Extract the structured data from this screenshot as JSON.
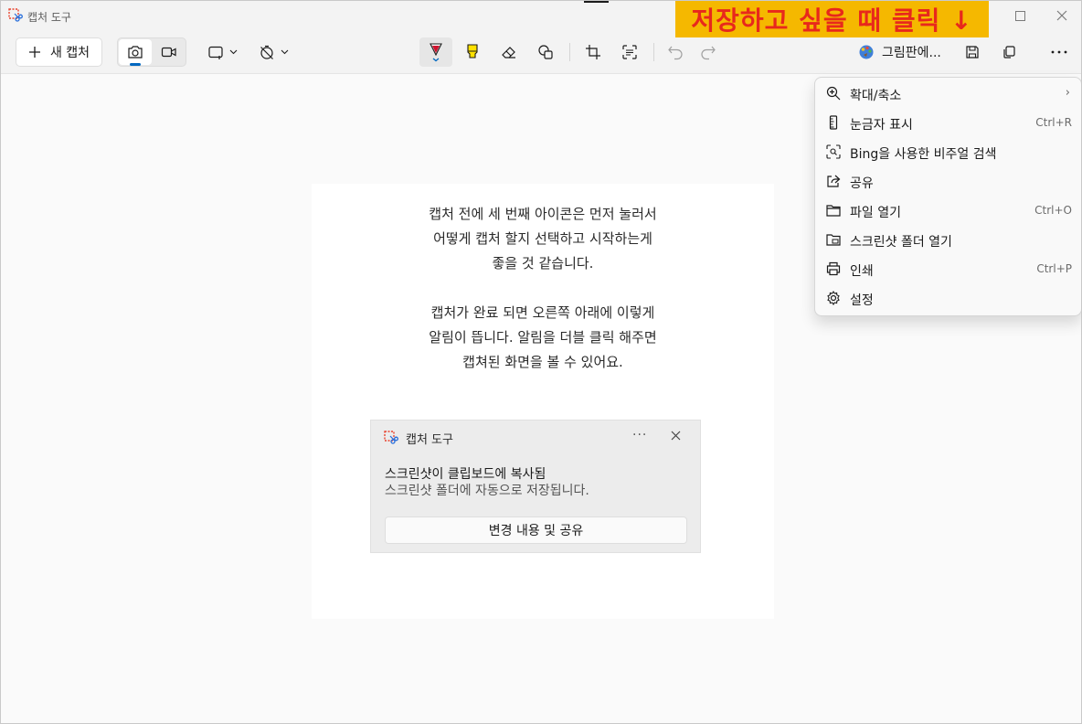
{
  "window": {
    "title": "캡처 도구"
  },
  "annotation": {
    "text": "저장하고 싶을 때 클릭 ↓",
    "bg_color": "#f5b800",
    "text_color": "#e8281c"
  },
  "toolbar": {
    "new_capture_label": "새 캡처",
    "paint_label": "그림판에...",
    "icons": [
      "camera-icon",
      "video-icon",
      "rect-select-icon",
      "no-timer-icon",
      "pen-icon",
      "highlighter-icon",
      "eraser-icon",
      "shapes-icon",
      "crop-icon",
      "text-actions-icon",
      "undo-icon",
      "redo-icon",
      "paint-app-icon",
      "save-icon",
      "copy-icon",
      "more-icon"
    ],
    "accent": "#0067c0"
  },
  "instructions": {
    "paragraph1": [
      "캡처 전에 세 번째 아이콘은 먼저 눌러서",
      "어떻게 캡처 할지 선택하고 시작하는게",
      "좋을 것 같습니다."
    ],
    "paragraph2": [
      "캡처가 완료 되면 오른쪽 아래에 이렇게",
      "알림이 뜹니다. 알림을 더블 클릭 해주면",
      "캡쳐된 화면을 볼 수 있어요."
    ]
  },
  "toast": {
    "app_name": "캡처 도구",
    "more": "···",
    "title": "스크린샷이 클립보드에 복사됨",
    "body": "스크린샷 폴더에 자동으로 저장됩니다.",
    "action": "변경 내용 및 공유"
  },
  "menu": {
    "items": [
      {
        "label": "확대/축소",
        "shortcut": "",
        "arrow": "›",
        "icon": "zoom-icon"
      },
      {
        "label": "눈금자 표시",
        "shortcut": "Ctrl+R",
        "icon": "ruler-icon"
      },
      {
        "label": "Bing을 사용한 비주얼 검색",
        "shortcut": "",
        "icon": "visual-search-icon"
      },
      {
        "label": "공유",
        "shortcut": "",
        "icon": "share-icon"
      },
      {
        "label": "파일 열기",
        "shortcut": "Ctrl+O",
        "icon": "folder-icon"
      },
      {
        "label": "스크린샷 폴더 열기",
        "shortcut": "",
        "icon": "screenshot-folder-icon"
      },
      {
        "label": "인쇄",
        "shortcut": "Ctrl+P",
        "icon": "printer-icon"
      },
      {
        "label": "설정",
        "shortcut": "",
        "icon": "settings-icon"
      }
    ]
  }
}
